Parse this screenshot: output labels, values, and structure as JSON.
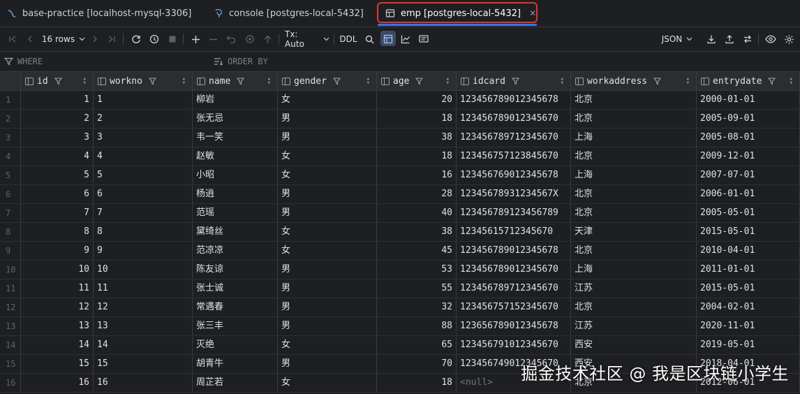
{
  "tabs": [
    {
      "label": "base-practice [localhost-mysql-3306]",
      "icon": "mysql-icon",
      "active": false
    },
    {
      "label": "console [postgres-local-5432]",
      "icon": "postgres-icon",
      "active": false
    },
    {
      "label": "emp [postgres-local-5432]",
      "icon": "table-icon",
      "active": true
    }
  ],
  "toolbar": {
    "rows_label": "16 rows",
    "tx_label": "Tx: Auto",
    "ddl_label": "DDL",
    "format_label": "JSON"
  },
  "filters": {
    "where_label": "WHERE",
    "orderby_label": "ORDER BY"
  },
  "columns": [
    "id",
    "workno",
    "name",
    "gender",
    "age",
    "idcard",
    "workaddress",
    "entrydate"
  ],
  "rows": [
    {
      "n": "1",
      "id": "1",
      "workno": "1",
      "name": "柳岩",
      "gender": "女",
      "age": "20",
      "idcard": "123456789012345678",
      "workaddress": "北京",
      "entrydate": "2000-01-01"
    },
    {
      "n": "2",
      "id": "2",
      "workno": "2",
      "name": "张无忌",
      "gender": "男",
      "age": "18",
      "idcard": "123456789012345670",
      "workaddress": "北京",
      "entrydate": "2005-09-01"
    },
    {
      "n": "3",
      "id": "3",
      "workno": "3",
      "name": "韦一笑",
      "gender": "男",
      "age": "38",
      "idcard": "123456789712345670",
      "workaddress": "上海",
      "entrydate": "2005-08-01"
    },
    {
      "n": "4",
      "id": "4",
      "workno": "4",
      "name": "赵敏",
      "gender": "女",
      "age": "18",
      "idcard": "123456757123845670",
      "workaddress": "北京",
      "entrydate": "2009-12-01"
    },
    {
      "n": "5",
      "id": "5",
      "workno": "5",
      "name": "小昭",
      "gender": "女",
      "age": "16",
      "idcard": "123456769012345678",
      "workaddress": "上海",
      "entrydate": "2007-07-01"
    },
    {
      "n": "6",
      "id": "6",
      "workno": "6",
      "name": "杨逍",
      "gender": "男",
      "age": "28",
      "idcard": "12345678931234567X",
      "workaddress": "北京",
      "entrydate": "2006-01-01"
    },
    {
      "n": "7",
      "id": "7",
      "workno": "7",
      "name": "范瑶",
      "gender": "男",
      "age": "40",
      "idcard": "123456789123456789",
      "workaddress": "北京",
      "entrydate": "2005-05-01"
    },
    {
      "n": "8",
      "id": "8",
      "workno": "8",
      "name": "黛绮丝",
      "gender": "女",
      "age": "38",
      "idcard": "12345615712345670",
      "workaddress": "天津",
      "entrydate": "2015-05-01"
    },
    {
      "n": "9",
      "id": "9",
      "workno": "9",
      "name": "范凉凉",
      "gender": "女",
      "age": "45",
      "idcard": "123456789012345678",
      "workaddress": "北京",
      "entrydate": "2010-04-01"
    },
    {
      "n": "10",
      "id": "10",
      "workno": "10",
      "name": "陈友谅",
      "gender": "男",
      "age": "53",
      "idcard": "123456789012345670",
      "workaddress": "上海",
      "entrydate": "2011-01-01"
    },
    {
      "n": "11",
      "id": "11",
      "workno": "11",
      "name": "张士诚",
      "gender": "男",
      "age": "55",
      "idcard": "123456789712345670",
      "workaddress": "江苏",
      "entrydate": "2015-05-01"
    },
    {
      "n": "12",
      "id": "12",
      "workno": "12",
      "name": "常遇春",
      "gender": "男",
      "age": "32",
      "idcard": "123456757152345670",
      "workaddress": "北京",
      "entrydate": "2004-02-01"
    },
    {
      "n": "13",
      "id": "13",
      "workno": "13",
      "name": "张三丰",
      "gender": "男",
      "age": "88",
      "idcard": "123656789012345678",
      "workaddress": "江苏",
      "entrydate": "2020-11-01"
    },
    {
      "n": "14",
      "id": "14",
      "workno": "14",
      "name": "灭绝",
      "gender": "女",
      "age": "65",
      "idcard": "123456791012345670",
      "workaddress": "西安",
      "entrydate": "2019-05-01"
    },
    {
      "n": "15",
      "id": "15",
      "workno": "15",
      "name": "胡青牛",
      "gender": "男",
      "age": "70",
      "idcard": "123456749012345670",
      "workaddress": "西安",
      "entrydate": "2018-04-01"
    },
    {
      "n": "16",
      "id": "16",
      "workno": "16",
      "name": "周芷若",
      "gender": "女",
      "age": "18",
      "idcard": "<null>",
      "workaddress": "北京",
      "entrydate": "2012-06-01"
    }
  ],
  "watermark": "掘金技术社区 @ 我是区块链小学生",
  "colors": {
    "accent": "#3574f0",
    "highlight": "#e5352b",
    "background": "#1e1f22",
    "header": "#2b2d30"
  }
}
